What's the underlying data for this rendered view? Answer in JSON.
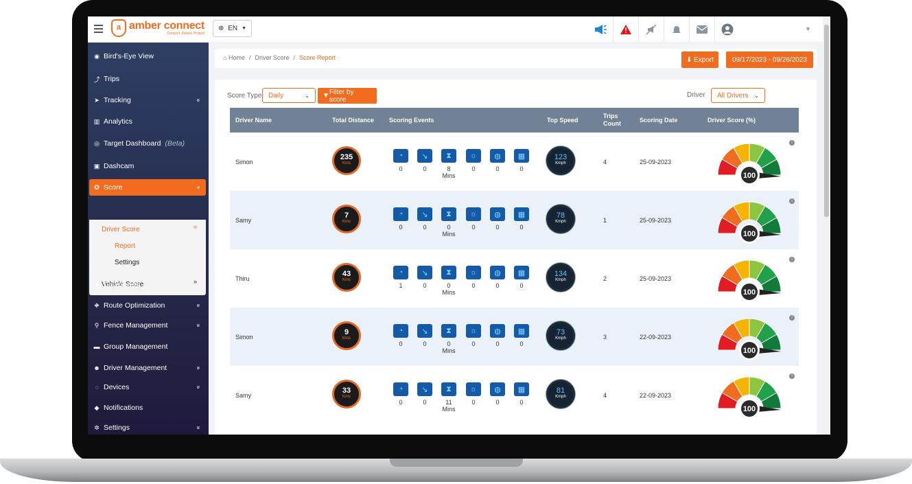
{
  "topbar": {
    "logo_mark": "a",
    "logo_text": "amber connect",
    "logo_tagline": "Connect. Detect. Protect",
    "language": "EN"
  },
  "sidebar": {
    "items": [
      {
        "label": "Bird's-Eye View",
        "icon": "eye-icon",
        "chevron": false
      },
      {
        "label": "Trips",
        "icon": "route-icon",
        "chevron": false
      },
      {
        "label": "Tracking",
        "icon": "navigation-arrow-icon",
        "chevron": true
      },
      {
        "label": "Analytics",
        "icon": "bar-chart-icon",
        "chevron": false
      },
      {
        "label": "Target Dashboard",
        "suffix": "(Beta)",
        "icon": "target-icon",
        "chevron": false
      },
      {
        "label": "Dashcam",
        "icon": "camera-icon",
        "chevron": false
      },
      {
        "label": "Score",
        "icon": "award-icon",
        "chevron": true,
        "active": true
      },
      {
        "label": "Downloads",
        "icon": "download-icon",
        "chevron": false
      },
      {
        "label": "Route Optimization",
        "icon": "route-optimization-icon",
        "chevron": true
      },
      {
        "label": "Fence Management",
        "icon": "map-pin-icon",
        "chevron": true
      },
      {
        "label": "Group Management",
        "icon": "truck-icon",
        "chevron": false
      },
      {
        "label": "Driver Management",
        "icon": "users-icon",
        "chevron": true
      },
      {
        "label": "Devices",
        "icon": "signal-icon",
        "chevron": true
      },
      {
        "label": "Notifications",
        "icon": "bell-icon",
        "chevron": false
      },
      {
        "label": "Settings",
        "icon": "gear-icon",
        "chevron": true
      }
    ],
    "score_sub": {
      "driver_score": "Driver Score",
      "report": "Report",
      "settings": "Settings",
      "vehicle_score": "Vehicle Score"
    }
  },
  "breadcrumb": {
    "home": "Home",
    "sep": "/",
    "level2": "Driver Score",
    "current": "Score Report"
  },
  "actions": {
    "export": "Export",
    "date_range": "09/17/2023 - 09/26/2023"
  },
  "filters": {
    "score_type_label": "Score Type",
    "score_type_value": "Daily",
    "filter_button": "Filter by score",
    "driver_label": "Driver",
    "driver_value": "All Drivers"
  },
  "table": {
    "headers": [
      "Driver Name",
      "Total Distance",
      "Scoring Events",
      "Top Speed",
      "Trips Count",
      "Scoring Date",
      "Driver Score (%)"
    ],
    "distance_unit": "Kms",
    "speed_unit": "Kmph",
    "score_label_unit": "Mins",
    "rows": [
      {
        "name": "Simon",
        "distance": "235",
        "events": [
          "0",
          "0",
          "8",
          "0",
          "0",
          "0"
        ],
        "speed": "123",
        "trips": "4",
        "date": "25-09-2023",
        "score": "100"
      },
      {
        "name": "Samy",
        "distance": "7",
        "events": [
          "0",
          "0",
          "0",
          "0",
          "0",
          "0"
        ],
        "speed": "78",
        "trips": "1",
        "date": "25-09-2023",
        "score": "100"
      },
      {
        "name": "Thiru",
        "distance": "43",
        "events": [
          "1",
          "0",
          "0",
          "0",
          "0",
          "0"
        ],
        "speed": "134",
        "trips": "2",
        "date": "25-09-2023",
        "score": "100"
      },
      {
        "name": "Simon",
        "distance": "9",
        "events": [
          "0",
          "0",
          "0",
          "0",
          "0",
          "0"
        ],
        "speed": "73",
        "trips": "3",
        "date": "22-09-2023",
        "score": "100"
      },
      {
        "name": "Samy",
        "distance": "33",
        "events": [
          "0",
          "0",
          "11",
          "0",
          "0",
          "0"
        ],
        "speed": "81",
        "trips": "4",
        "date": "22-09-2023",
        "score": "100"
      }
    ]
  },
  "colors": {
    "accent": "#f26c1f",
    "sidebar": "#2e3e63",
    "header": "#718196",
    "event_icon": "#145aa6"
  }
}
